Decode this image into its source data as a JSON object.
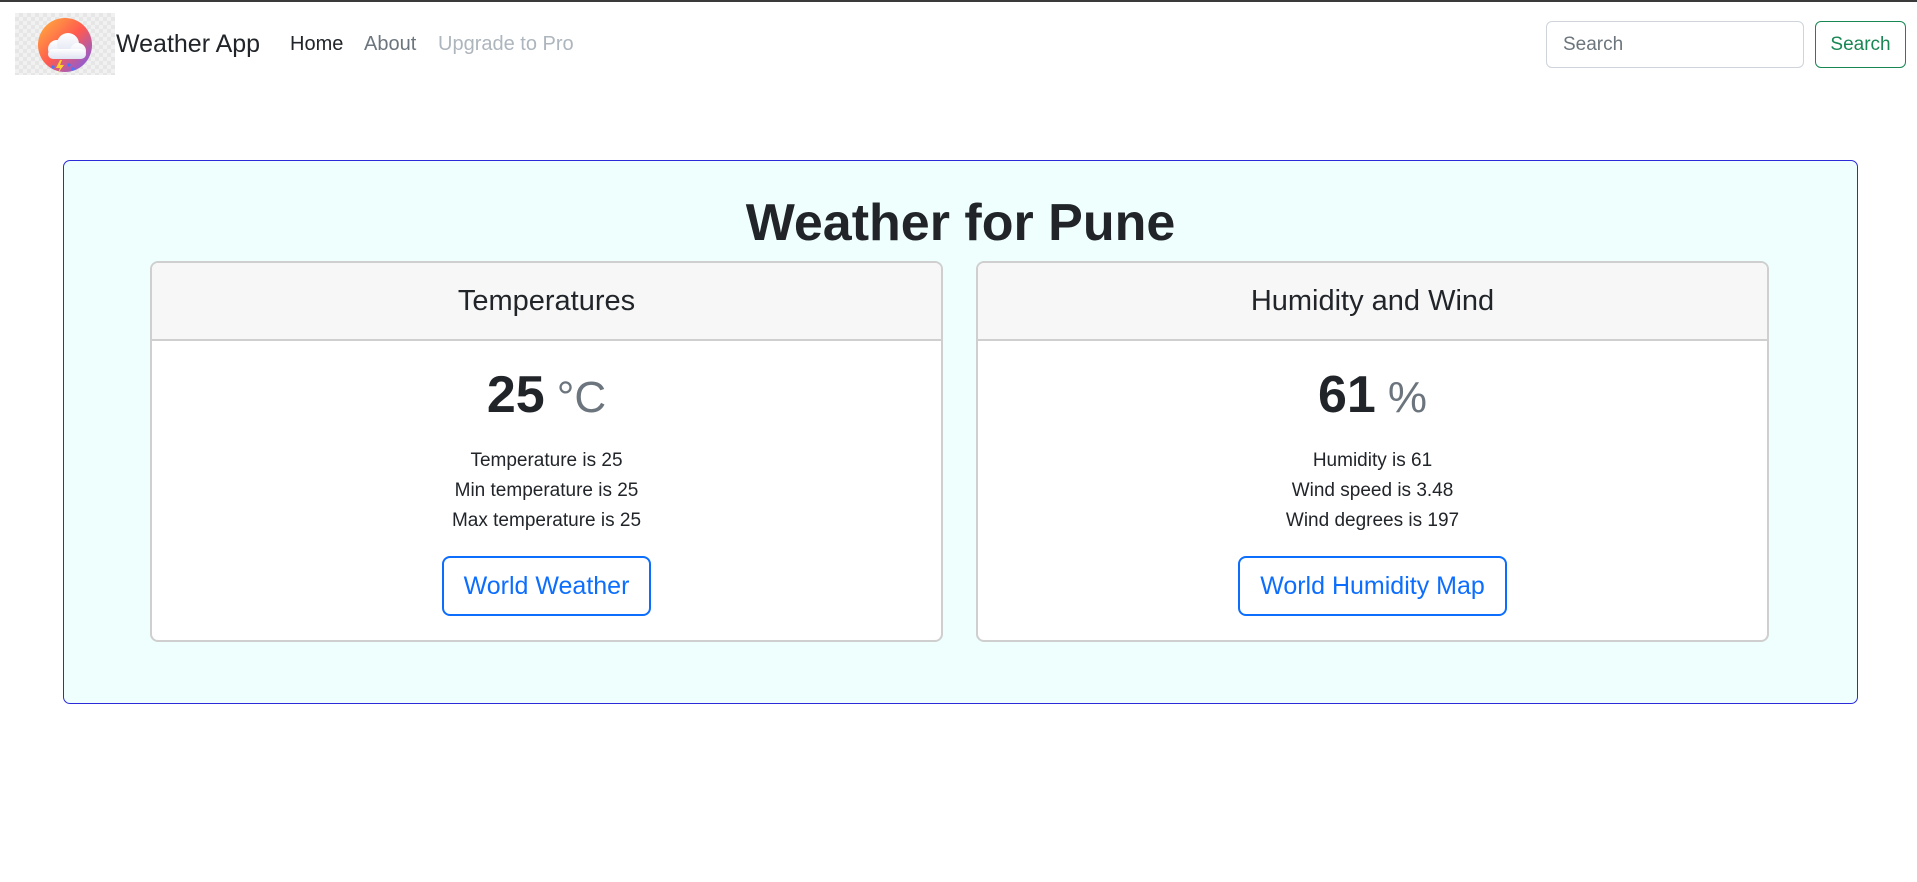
{
  "navbar": {
    "brand": "Weather App",
    "links": [
      {
        "label": "Home"
      },
      {
        "label": "About"
      },
      {
        "label": "Upgrade to Pro"
      }
    ],
    "search": {
      "placeholder": "Search",
      "value": "",
      "button_label": "Search"
    }
  },
  "main": {
    "title": "Weather for Pune",
    "cards": [
      {
        "header": "Temperatures",
        "value": "25",
        "unit": "°C",
        "lines": [
          "Temperature is 25",
          "Min temperature is 25",
          "Max temperature is 25"
        ],
        "button_label": "World Weather"
      },
      {
        "header": "Humidity and Wind",
        "value": "61",
        "unit": "%",
        "lines": [
          "Humidity is 61",
          "Wind speed is 3.48",
          "Wind degrees is 197"
        ],
        "button_label": "World Humidity Map"
      }
    ]
  },
  "colors": {
    "panel_bg": "#effffe",
    "panel_border": "#2b2bd9",
    "primary": "#0d6efd",
    "success": "#198754"
  }
}
